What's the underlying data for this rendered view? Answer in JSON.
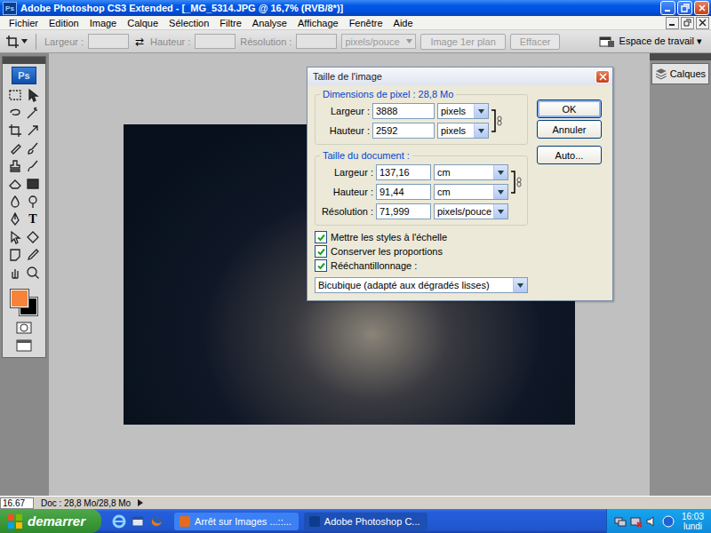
{
  "window": {
    "title": "Adobe Photoshop CS3 Extended - [_MG_5314.JPG @ 16,7% (RVB/8*)]",
    "badge": "Ps"
  },
  "menu": [
    "Fichier",
    "Edition",
    "Image",
    "Calque",
    "Sélection",
    "Filtre",
    "Analyse",
    "Affichage",
    "Fenêtre",
    "Aide"
  ],
  "options_bar": {
    "fields": [
      {
        "label": "Largeur :",
        "value": "",
        "disabled": true
      },
      {
        "label": "Hauteur :",
        "value": "",
        "disabled": true
      },
      {
        "label": "Résolution :",
        "value": "",
        "disabled": true
      }
    ],
    "swap": "⇄",
    "unit": {
      "value": "pixels/pouce",
      "disabled": true
    },
    "buttons": [
      {
        "label": "Image 1er plan",
        "disabled": true
      },
      {
        "label": "Effacer",
        "disabled": true
      }
    ],
    "workspace": "Espace de travail ▾"
  },
  "toolbox": {
    "badge": "Ps",
    "type_glyph": "T",
    "swatches": [
      {
        "name": "foreground",
        "color": "#f7833a"
      },
      {
        "name": "background",
        "color": "#000000"
      }
    ]
  },
  "panels": [
    {
      "label": "Calques"
    }
  ],
  "dialog": {
    "title": "Taille de l'image",
    "pixel_dimensions": {
      "legend": "Dimensions de pixel :",
      "size": "28,8 Mo",
      "rows": [
        {
          "label": "Largeur :",
          "value": "3888",
          "unit": "pixels"
        },
        {
          "label": "Hauteur :",
          "value": "2592",
          "unit": "pixels"
        }
      ]
    },
    "document_size": {
      "legend": "Taille du document :",
      "rows": [
        {
          "label": "Largeur :",
          "value": "137,16",
          "unit": "cm"
        },
        {
          "label": "Hauteur :",
          "value": "91,44",
          "unit": "cm"
        }
      ],
      "resolution": {
        "label": "Résolution :",
        "value": "71,999",
        "unit": "pixels/pouce"
      }
    },
    "checks": [
      {
        "label": "Mettre les styles à l'échelle",
        "checked": true
      },
      {
        "label": "Conserver les proportions",
        "checked": true
      },
      {
        "label": "Rééchantillonnage :",
        "checked": true
      }
    ],
    "method": "Bicubique (adapté aux dégradés lisses)",
    "buttons": [
      "OK",
      "Annuler",
      "Auto..."
    ]
  },
  "status_bar": {
    "zoom": "16.67",
    "doc": "Doc : 28,8 Mo/28,8 Mo"
  },
  "taskbar": {
    "start": "demarrer",
    "tasks": [
      {
        "label": "Arrêt sur Images ...::...",
        "selected": false
      },
      {
        "label": "Adobe Photoshop C...",
        "selected": true
      }
    ],
    "time": "16:03",
    "day": "lundi"
  }
}
